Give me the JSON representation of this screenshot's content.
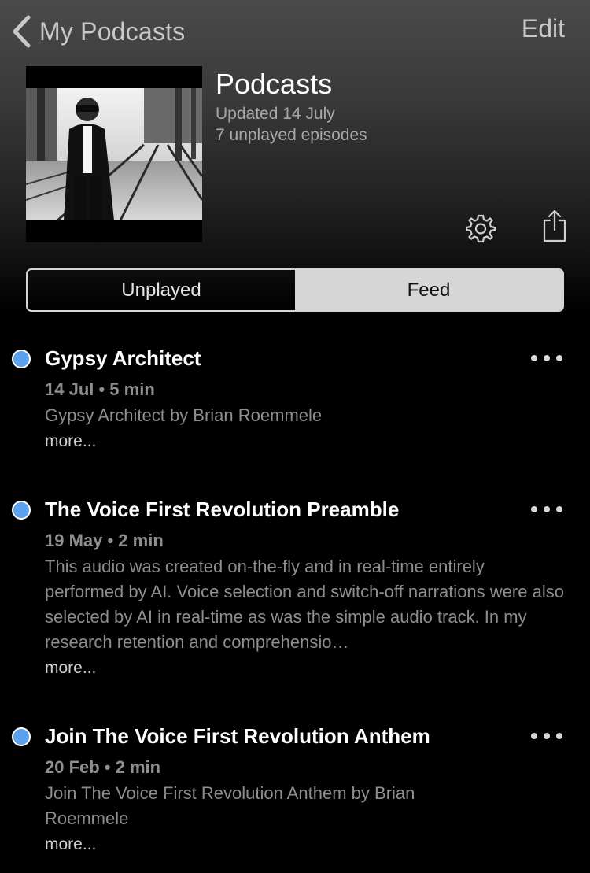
{
  "nav": {
    "back_label": "My Podcasts",
    "edit_label": "Edit"
  },
  "header": {
    "title": "Podcasts",
    "updated": "Updated 14 July",
    "unplayed_count": "7 unplayed episodes"
  },
  "segments": {
    "unplayed": "Unplayed",
    "feed": "Feed",
    "selected": "Feed"
  },
  "episodes": [
    {
      "title": "Gypsy Architect",
      "meta": "14 Jul • 5 min",
      "description": "Gypsy Architect by Brian Roemmele",
      "more": "more..."
    },
    {
      "title": "The Voice First Revolution Preamble",
      "meta": "19 May • 2 min",
      "description": "This audio was created on-the-fly and in real-time entirely performed by AI. Voice selection and switch-off narrations were also selected by AI in real-time as was the simple audio track. In my research retention and comprehensio…",
      "more": "more..."
    },
    {
      "title": "Join The Voice First Revolution Anthem",
      "meta": "20 Feb • 2 min",
      "description": "Join The Voice First Revolution Anthem by Brian Roemmele",
      "more": "more..."
    }
  ],
  "colors": {
    "unplayed_dot": "#5aa2ef",
    "accent_text": "#c8c8c8",
    "segment_selected_bg": "#d6d6d6"
  },
  "icons": {
    "back": "chevron-left-icon",
    "settings": "gear-icon",
    "share": "share-icon",
    "episode_actions": "ellipsis-icon"
  }
}
